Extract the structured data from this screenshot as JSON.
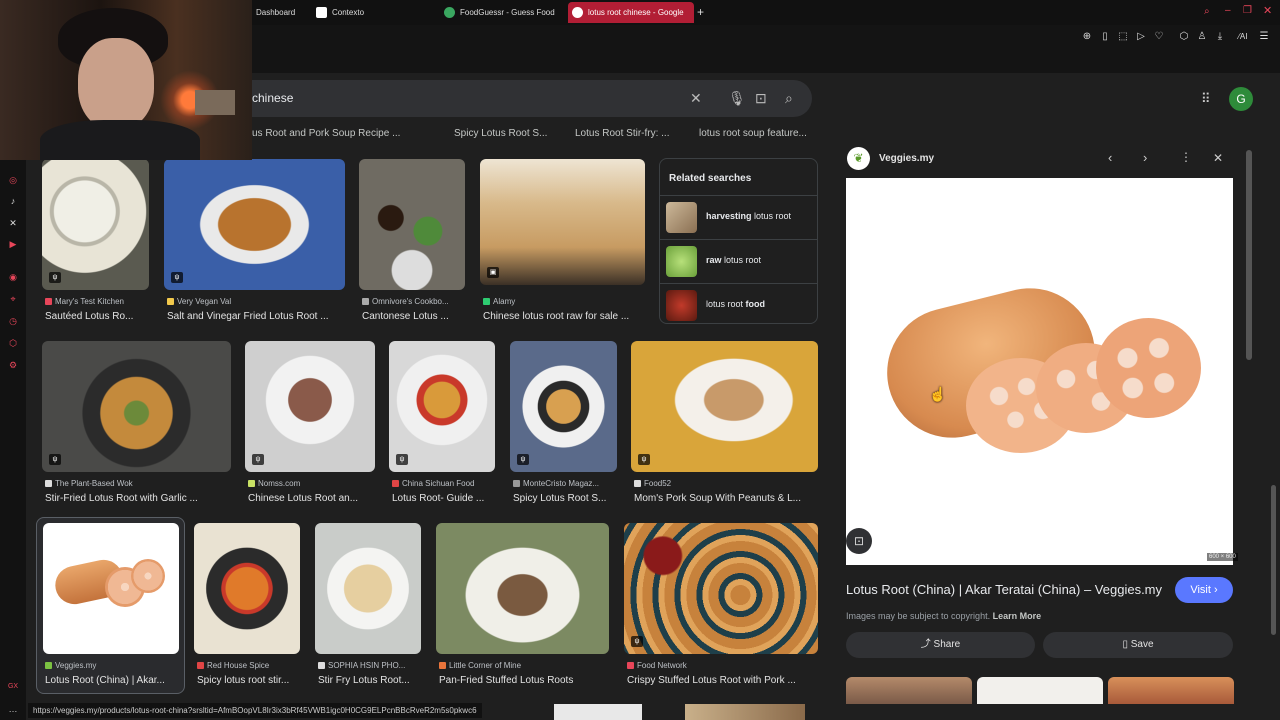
{
  "tabs": [
    {
      "label": "Dashboard",
      "color": "#3b6fd8"
    },
    {
      "label": "Contexto",
      "color": "#ffffff"
    },
    {
      "label": "FoodGuessr - Guess Food",
      "color": "#3aa760"
    },
    {
      "label": "lotus root chinese - Google",
      "color": "#4285f4"
    }
  ],
  "search": {
    "query": "chinese"
  },
  "chips": [
    "us Root and Pork Soup Recipe ...",
    "Spicy Lotus Root S...",
    "Lotus Root Stir-fry: ...",
    "lotus root soup feature..."
  ],
  "avatar_letter": "G",
  "results": [
    {
      "source": "Mary's Test Kitchen",
      "title": "Sautéed Lotus Ro...",
      "fav": "#e8465a"
    },
    {
      "source": "Very Vegan Val",
      "title": "Salt and Vinegar Fried Lotus Root ...",
      "fav": "#f2c94c"
    },
    {
      "source": "Omnivore's Cookbo...",
      "title": "Cantonese Lotus ...",
      "fav": "#aaaaaa"
    },
    {
      "source": "Alamy",
      "title": "Chinese lotus root raw for sale ...",
      "fav": "#2ecc71"
    },
    {
      "source": "The Plant-Based Wok",
      "title": "Stir-Fried Lotus Root with Garlic ...",
      "fav": "#dddddd"
    },
    {
      "source": "Nomss.com",
      "title": "Chinese Lotus Root an...",
      "fav": "#c9e265"
    },
    {
      "source": "China Sichuan Food",
      "title": "Lotus Root- Guide ...",
      "fav": "#e04545"
    },
    {
      "source": "MonteCristo Magaz...",
      "title": "Spicy Lotus Root S...",
      "fav": "#999999"
    },
    {
      "source": "Food52",
      "title": "Mom's Pork Soup With Peanuts & L...",
      "fav": "#dddddd"
    },
    {
      "source": "Veggies.my",
      "title": "Lotus Root (China) | Akar...",
      "fav": "#7cc242"
    },
    {
      "source": "Red House Spice",
      "title": "Spicy lotus root stir...",
      "fav": "#e04545"
    },
    {
      "source": "SOPHIA HSIN PHO...",
      "title": "Stir Fry Lotus Root...",
      "fav": "#dddddd"
    },
    {
      "source": "Little Corner of Mine",
      "title": "Pan-Fried Stuffed Lotus Roots",
      "fav": "#e8743b"
    },
    {
      "source": "Food Network",
      "title": "Crispy Stuffed Lotus Root with Pork ...",
      "fav": "#e8465a"
    }
  ],
  "related": {
    "header": "Related searches",
    "items": [
      {
        "bold": "harvesting",
        "text": " lotus root"
      },
      {
        "bold": "raw",
        "text": " lotus root"
      },
      {
        "bold": "",
        "text": "lotus root ",
        "bold_after": "food"
      }
    ]
  },
  "preview": {
    "site": "Veggies.my",
    "dims": "600 × 600",
    "title": "Lotus Root (China) | Akar Teratai (China) – Veggies.my",
    "visit": "Visit",
    "copyright": "Images may be subject to copyright.",
    "learn_more": "Learn More",
    "share": "Share",
    "save": "Save"
  },
  "status_url": "https://veggies.my/products/lotus-root-china?srsltid=AfmBOopVL8Ir3ix3bRf45VWB1igc0H0CG9ELPcnBBcRveR2m5s0pkwc6"
}
